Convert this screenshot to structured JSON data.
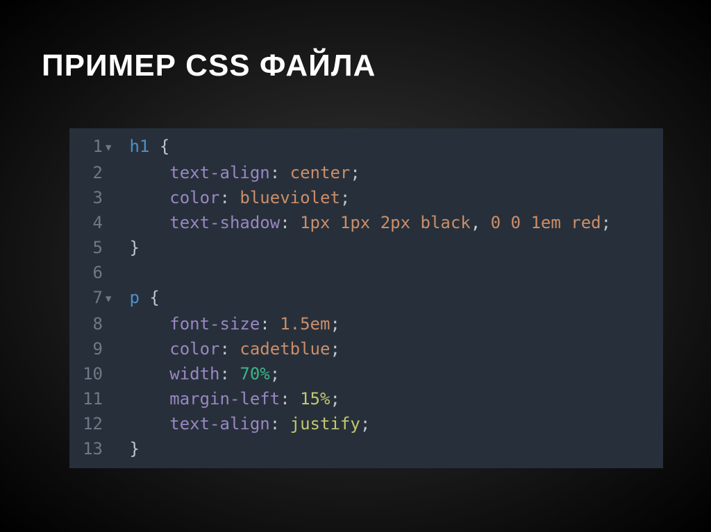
{
  "title": "ПРИМЕР CSS ФАЙЛА",
  "code": {
    "lines": [
      {
        "num": "1",
        "fold": "▼",
        "segments": [
          {
            "t": " ",
            "c": ""
          },
          {
            "t": "h1",
            "c": "c-selector"
          },
          {
            "t": " ",
            "c": ""
          },
          {
            "t": "{",
            "c": "c-brace"
          }
        ]
      },
      {
        "num": "2",
        "fold": "",
        "segments": [
          {
            "t": "     ",
            "c": ""
          },
          {
            "t": "text-align",
            "c": "c-prop"
          },
          {
            "t": ": ",
            "c": "c-colon"
          },
          {
            "t": "center",
            "c": "c-value"
          },
          {
            "t": ";",
            "c": "c-punct"
          }
        ]
      },
      {
        "num": "3",
        "fold": "",
        "segments": [
          {
            "t": "     ",
            "c": ""
          },
          {
            "t": "color",
            "c": "c-prop"
          },
          {
            "t": ": ",
            "c": "c-colon"
          },
          {
            "t": "blueviolet",
            "c": "c-value"
          },
          {
            "t": ";",
            "c": "c-punct"
          }
        ]
      },
      {
        "num": "4",
        "fold": "",
        "segments": [
          {
            "t": "     ",
            "c": ""
          },
          {
            "t": "text-shadow",
            "c": "c-prop"
          },
          {
            "t": ": ",
            "c": "c-colon"
          },
          {
            "t": "1px 1px 2px black",
            "c": "c-value"
          },
          {
            "t": ", ",
            "c": "c-white"
          },
          {
            "t": "0 0 1em red",
            "c": "c-value"
          },
          {
            "t": ";",
            "c": "c-punct"
          }
        ]
      },
      {
        "num": "5",
        "fold": "",
        "segments": [
          {
            "t": " ",
            "c": ""
          },
          {
            "t": "}",
            "c": "c-brace"
          }
        ]
      },
      {
        "num": "6",
        "fold": "",
        "segments": [
          {
            "t": " ",
            "c": ""
          }
        ]
      },
      {
        "num": "7",
        "fold": "▼",
        "segments": [
          {
            "t": " ",
            "c": ""
          },
          {
            "t": "p",
            "c": "c-selector"
          },
          {
            "t": " ",
            "c": ""
          },
          {
            "t": "{",
            "c": "c-brace"
          }
        ]
      },
      {
        "num": "8",
        "fold": "",
        "segments": [
          {
            "t": "     ",
            "c": ""
          },
          {
            "t": "font-size",
            "c": "c-prop"
          },
          {
            "t": ": ",
            "c": "c-colon"
          },
          {
            "t": "1.5em",
            "c": "c-value"
          },
          {
            "t": ";",
            "c": "c-punct"
          }
        ]
      },
      {
        "num": "9",
        "fold": "",
        "segments": [
          {
            "t": "     ",
            "c": ""
          },
          {
            "t": "color",
            "c": "c-prop"
          },
          {
            "t": ": ",
            "c": "c-colon"
          },
          {
            "t": "cadetblue",
            "c": "c-value"
          },
          {
            "t": ";",
            "c": "c-punct"
          }
        ]
      },
      {
        "num": "10",
        "fold": "",
        "segments": [
          {
            "t": "     ",
            "c": ""
          },
          {
            "t": "width",
            "c": "c-prop"
          },
          {
            "t": ": ",
            "c": "c-colon"
          },
          {
            "t": "70%",
            "c": "c-number"
          },
          {
            "t": ";",
            "c": "c-punct"
          }
        ]
      },
      {
        "num": "11",
        "fold": "",
        "segments": [
          {
            "t": "     ",
            "c": ""
          },
          {
            "t": "margin-left",
            "c": "c-prop"
          },
          {
            "t": ": ",
            "c": "c-colon"
          },
          {
            "t": "15%",
            "c": "c-value2"
          },
          {
            "t": ";",
            "c": "c-punct"
          }
        ]
      },
      {
        "num": "12",
        "fold": "",
        "segments": [
          {
            "t": "     ",
            "c": ""
          },
          {
            "t": "text-align",
            "c": "c-prop"
          },
          {
            "t": ": ",
            "c": "c-colon"
          },
          {
            "t": "justify",
            "c": "c-value2"
          },
          {
            "t": ";",
            "c": "c-punct"
          }
        ]
      },
      {
        "num": "13",
        "fold": "",
        "segments": [
          {
            "t": " ",
            "c": ""
          },
          {
            "t": "}",
            "c": "c-brace"
          }
        ]
      }
    ]
  }
}
